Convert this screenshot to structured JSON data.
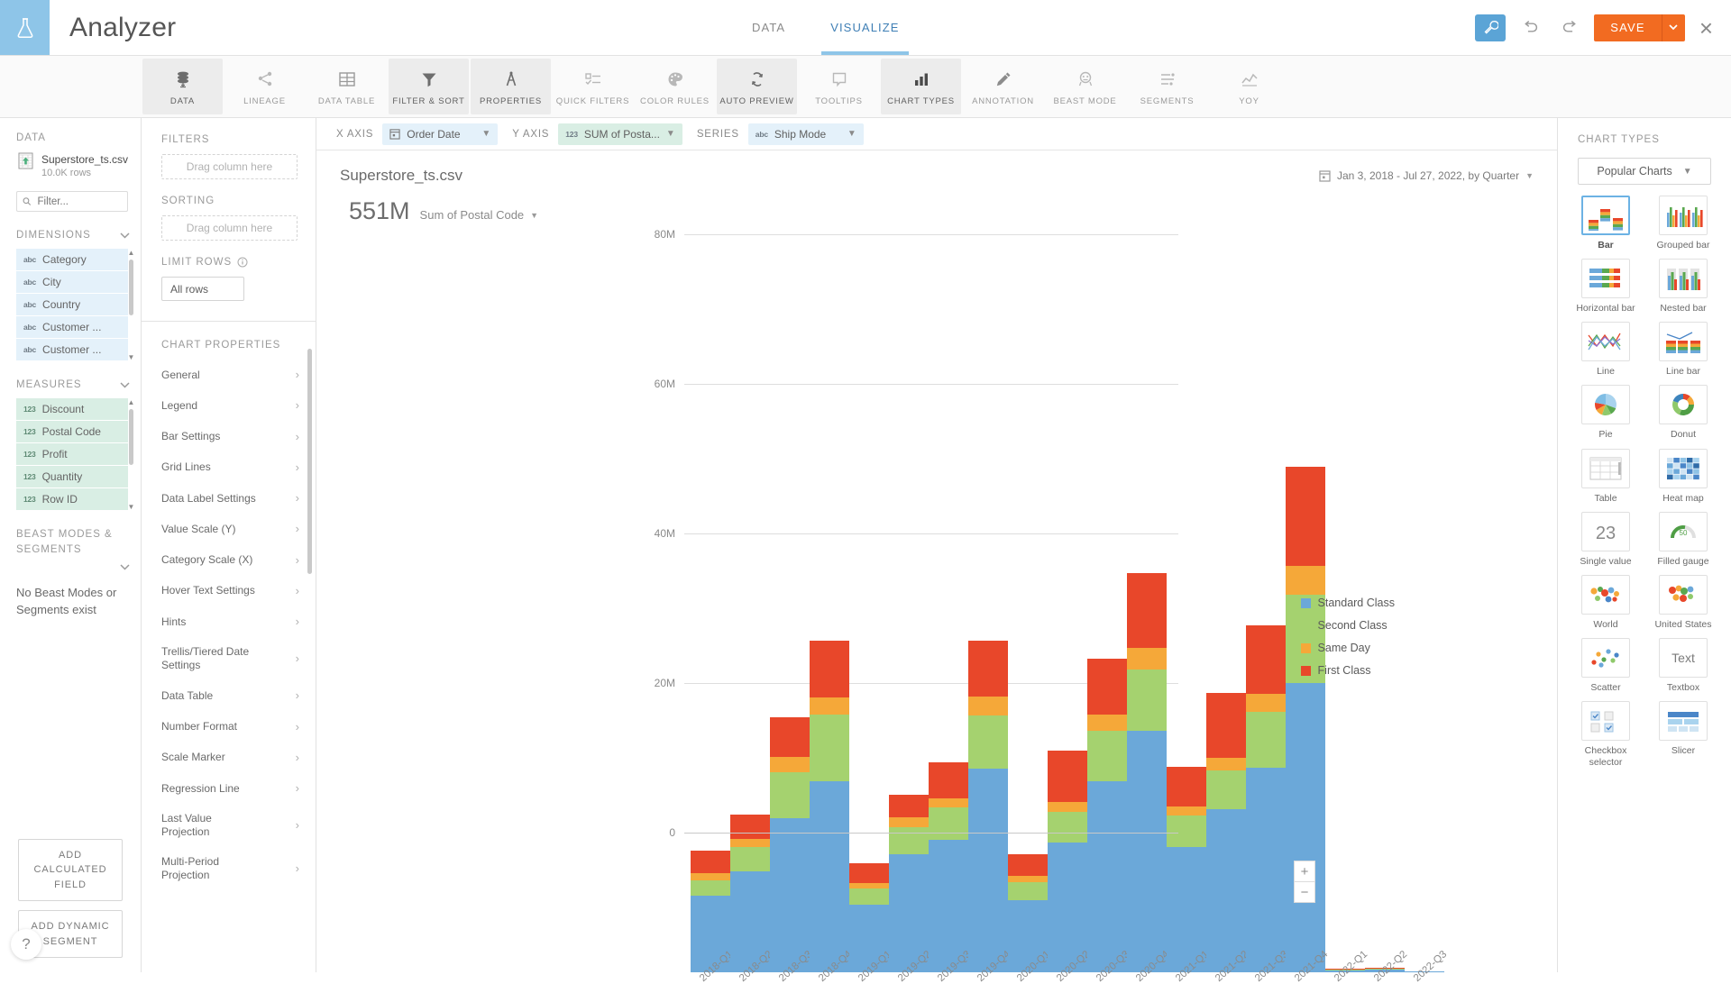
{
  "app": {
    "title": "Analyzer",
    "logo_icon": "flask-icon",
    "tabs": [
      {
        "label": "DATA",
        "active": false
      },
      {
        "label": "VISUALIZE",
        "active": true
      }
    ],
    "actions": {
      "tools_icon": "wrench-icon",
      "undo_icon": "undo-arrow-icon",
      "redo_icon": "redo-arrow-icon",
      "save_label": "SAVE",
      "save_caret_icon": "chevron-down-icon",
      "close_icon": "close-x-icon",
      "accent_orange": "#f26b21",
      "accent_blue": "#5ba4d6"
    }
  },
  "toolbar": {
    "items": [
      {
        "label": "DATA",
        "icon": "database-icon",
        "selected": true
      },
      {
        "label": "LINEAGE",
        "icon": "lineage-icon",
        "selected": false
      },
      {
        "label": "DATA TABLE",
        "icon": "table-grid-icon",
        "selected": false
      },
      {
        "label": "FILTER & SORT",
        "icon": "funnel-icon",
        "selected": true
      },
      {
        "label": "PROPERTIES",
        "icon": "compass-icon",
        "selected": true
      },
      {
        "label": "QUICK FILTERS",
        "icon": "checklist-icon",
        "selected": false
      },
      {
        "label": "COLOR RULES",
        "icon": "palette-icon",
        "selected": false
      },
      {
        "label": "AUTO PREVIEW",
        "icon": "refresh-cycle-icon",
        "selected": true
      },
      {
        "label": "TOOLTIPS",
        "icon": "tooltip-bubble-icon",
        "selected": false
      },
      {
        "label": "CHART TYPES",
        "icon": "bar-chart-icon",
        "selected": true
      },
      {
        "label": "ANNOTATION",
        "icon": "pencil-icon",
        "selected": false
      },
      {
        "label": "BEAST MODE",
        "icon": "beast-mode-icon",
        "selected": false
      },
      {
        "label": "SEGMENTS",
        "icon": "segments-icon",
        "selected": false
      },
      {
        "label": "YOY",
        "icon": "yoy-icon",
        "selected": false
      }
    ]
  },
  "data_panel": {
    "section_label": "DATA",
    "dataset": {
      "icon": "csv-file-icon",
      "name": "Superstore_ts.csv",
      "rows": "10.0K rows"
    },
    "filter": {
      "icon": "search-icon",
      "placeholder": "Filter...",
      "value": ""
    },
    "dimensions": {
      "label": "DIMENSIONS",
      "collapse_icon": "chevron-down-icon",
      "items": [
        {
          "tag": "abc",
          "name": "Category"
        },
        {
          "tag": "abc",
          "name": "City"
        },
        {
          "tag": "abc",
          "name": "Country"
        },
        {
          "tag": "abc",
          "name": "Customer ..."
        },
        {
          "tag": "abc",
          "name": "Customer ..."
        }
      ]
    },
    "measures": {
      "label": "MEASURES",
      "collapse_icon": "chevron-down-icon",
      "items": [
        {
          "tag": "123",
          "name": "Discount"
        },
        {
          "tag": "123",
          "name": "Postal Code"
        },
        {
          "tag": "123",
          "name": "Profit"
        },
        {
          "tag": "123",
          "name": "Quantity"
        },
        {
          "tag": "123",
          "name": "Row ID"
        }
      ]
    },
    "beast": {
      "label": "BEAST MODES & SEGMENTS",
      "collapse_icon": "chevron-down-icon",
      "empty_text": "No Beast Modes or Segments exist"
    },
    "buttons": [
      {
        "label": "ADD CALCULATED FIELD"
      },
      {
        "label": "ADD DYNAMIC SEGMENT"
      }
    ],
    "help_icon": "question-mark-icon"
  },
  "properties_panel": {
    "filters": {
      "label": "FILTERS",
      "dropzone": "Drag column here"
    },
    "sorting": {
      "label": "SORTING",
      "dropzone": "Drag column here"
    },
    "limit_rows": {
      "label": "LIMIT ROWS",
      "info_icon": "info-circle-icon",
      "value": "All rows"
    },
    "chart_properties": {
      "label": "CHART PROPERTIES",
      "items": [
        "General",
        "Legend",
        "Bar Settings",
        "Grid Lines",
        "Data Label Settings",
        "Value Scale (Y)",
        "Category Scale (X)",
        "Hover Text Settings",
        "Hints",
        "Trellis/Tiered Date Settings",
        "Data Table",
        "Number Format",
        "Scale Marker",
        "Regression Line",
        "Last Value Projection",
        "Multi-Period Projection"
      ],
      "chevron_icon": "chevron-right-icon"
    }
  },
  "axis_bar": {
    "x": {
      "label": "X AXIS",
      "icon": "calendar-icon",
      "value": "Order Date",
      "caret_icon": "chevron-down-icon"
    },
    "y": {
      "label": "Y AXIS",
      "icon": "123",
      "value": "SUM of Posta...",
      "caret_icon": "chevron-down-icon"
    },
    "series": {
      "label": "SERIES",
      "icon": "abc",
      "value": "Ship Mode",
      "caret_icon": "chevron-down-icon"
    }
  },
  "chart_header": {
    "title": "Superstore_ts.csv",
    "date_range": {
      "icon": "calendar-icon",
      "text": "Jan 3, 2018 - Jul 27, 2022, by Quarter",
      "caret_icon": "chevron-down-icon"
    },
    "summary_value": "551M",
    "summary_label": "Sum of Postal Code",
    "summary_caret_icon": "chevron-down-icon"
  },
  "zoom_controls": {
    "zoom_in": "+",
    "zoom_out": "−"
  },
  "chart_data": {
    "type": "bar",
    "variant": "stacked",
    "title": "Superstore_ts.csv",
    "xlabel": "",
    "ylabel": "",
    "ylim": [
      0,
      80000000
    ],
    "ytick_labels": [
      "0",
      "20M",
      "40M",
      "60M",
      "80M"
    ],
    "ytick_values": [
      0,
      20000000,
      40000000,
      60000000,
      80000000
    ],
    "grid": true,
    "legend_position": "right",
    "categories": [
      "2018-Q1",
      "2018-Q2",
      "2018-Q3",
      "2018-Q4",
      "2019-Q1",
      "2019-Q2",
      "2019-Q3",
      "2019-Q4",
      "2020-Q1",
      "2020-Q2",
      "2020-Q3",
      "2020-Q4",
      "2021-Q1",
      "2021-Q2",
      "2021-Q3",
      "2021-Q4",
      "2022-Q1",
      "2022-Q2",
      "2022-Q3"
    ],
    "series": [
      {
        "name": "Standard Class",
        "color": "#6ba8d9",
        "values": [
          10200000,
          13500000,
          20600000,
          25500000,
          9000000,
          15800000,
          17700000,
          27200000,
          9700000,
          17400000,
          25500000,
          32300000,
          16800000,
          21800000,
          27300000,
          38700000,
          300000,
          400000,
          80000
        ]
      },
      {
        "name": "Second Class",
        "color": "#a5d26f",
        "values": [
          2100000,
          3200000,
          6200000,
          9000000,
          2200000,
          3600000,
          4300000,
          7200000,
          2400000,
          4100000,
          6800000,
          8200000,
          4200000,
          5200000,
          7500000,
          11800000,
          60000,
          90000,
          20000
        ]
      },
      {
        "name": "Same Day",
        "color": "#f5a839",
        "values": [
          900000,
          1100000,
          2000000,
          2300000,
          700000,
          1300000,
          1300000,
          2500000,
          800000,
          1300000,
          2200000,
          2900000,
          1200000,
          1700000,
          2400000,
          3900000,
          20000,
          30000,
          10000
        ]
      },
      {
        "name": "First Class",
        "color": "#e8472a",
        "values": [
          3100000,
          3300000,
          5300000,
          7600000,
          2700000,
          3100000,
          4800000,
          7500000,
          2900000,
          6800000,
          7400000,
          10000000,
          5300000,
          8700000,
          9200000,
          13200000,
          60000,
          80000,
          20000
        ]
      }
    ]
  },
  "chart_types_panel": {
    "label": "CHART TYPES",
    "selector": {
      "value": "Popular Charts",
      "caret_icon": "chevron-down-icon"
    },
    "items": [
      {
        "label": "Bar",
        "icon": "stacked-bar-thumb",
        "selected": true
      },
      {
        "label": "Grouped bar",
        "icon": "grouped-bar-thumb",
        "selected": false
      },
      {
        "label": "Horizontal bar",
        "icon": "horizontal-bar-thumb",
        "selected": false
      },
      {
        "label": "Nested bar",
        "icon": "nested-bar-thumb",
        "selected": false
      },
      {
        "label": "Line",
        "icon": "line-chart-thumb",
        "selected": false
      },
      {
        "label": "Line bar",
        "icon": "line-bar-thumb",
        "selected": false
      },
      {
        "label": "Pie",
        "icon": "pie-chart-thumb",
        "selected": false
      },
      {
        "label": "Donut",
        "icon": "donut-chart-thumb",
        "selected": false
      },
      {
        "label": "Table",
        "icon": "table-thumb",
        "selected": false
      },
      {
        "label": "Heat map",
        "icon": "heatmap-thumb",
        "selected": false
      },
      {
        "label": "Single value",
        "icon": "single-value-thumb",
        "selected": false,
        "sample": "23"
      },
      {
        "label": "Filled gauge",
        "icon": "filled-gauge-thumb",
        "selected": false,
        "sample": "50"
      },
      {
        "label": "World",
        "icon": "world-map-thumb",
        "selected": false
      },
      {
        "label": "United States",
        "icon": "us-map-thumb",
        "selected": false
      },
      {
        "label": "Scatter",
        "icon": "scatter-plot-thumb",
        "selected": false
      },
      {
        "label": "Textbox",
        "icon": "textbox-thumb",
        "selected": false,
        "sample": "Text"
      },
      {
        "label": "Checkbox selector",
        "icon": "checkbox-selector-thumb",
        "selected": false
      },
      {
        "label": "Slicer",
        "icon": "slicer-thumb",
        "selected": false
      }
    ]
  }
}
